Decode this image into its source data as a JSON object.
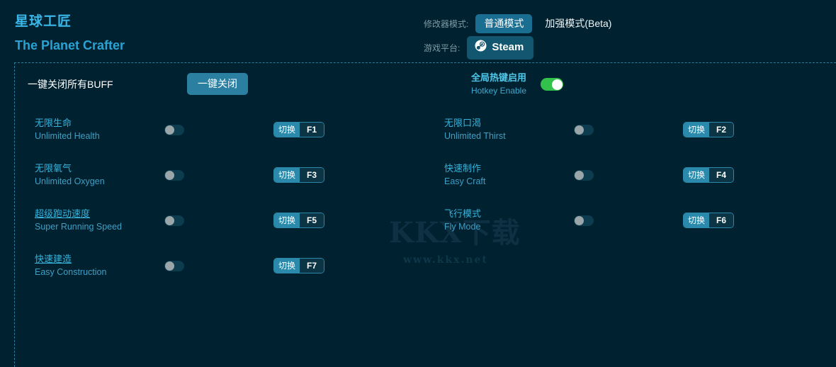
{
  "header": {
    "title_cn": "星球工匠",
    "title_en": "The Planet Crafter",
    "mode_label": "修改器模式:",
    "mode_active": "普通模式",
    "mode_inactive": "加强模式(Beta)",
    "platform_label": "游戏平台:",
    "platform_value": "Steam",
    "platform_icon": "steam-icon"
  },
  "utility": {
    "close_all_label": "一键关闭所有BUFF",
    "close_all_button": "一键关闭",
    "hotkey_cn": "全局热键启用",
    "hotkey_en": "Hotkey Enable",
    "hotkey_state": "on"
  },
  "colors": {
    "background": "#00212f",
    "accent": "#2b89ab",
    "title_cn": "#3ab7e8",
    "title_en": "#2aa3d4",
    "toggle_on": "#32c24b",
    "toggle_off_track": "#0c3c4e",
    "toggle_off_knob": "#9aa6aa",
    "panel_border": "#2a7e9c"
  },
  "cheats": [
    {
      "name_cn": "无限生命",
      "name_en": "Unlimited Health",
      "state": "off",
      "action": "切换",
      "key": "F1",
      "underlined": false,
      "column": 0,
      "row": 0
    },
    {
      "name_cn": "无限口渴",
      "name_en": "Unlimited Thirst",
      "state": "off",
      "action": "切换",
      "key": "F2",
      "underlined": false,
      "column": 1,
      "row": 0
    },
    {
      "name_cn": "无限氧气",
      "name_en": "Unlimited Oxygen",
      "state": "off",
      "action": "切换",
      "key": "F3",
      "underlined": false,
      "column": 0,
      "row": 1
    },
    {
      "name_cn": "快速制作",
      "name_en": "Easy Craft",
      "state": "off",
      "action": "切换",
      "key": "F4",
      "underlined": false,
      "column": 1,
      "row": 1
    },
    {
      "name_cn": "超级跑动速度",
      "name_en": "Super Running Speed",
      "state": "off",
      "action": "切换",
      "key": "F5",
      "underlined": true,
      "column": 0,
      "row": 2
    },
    {
      "name_cn": "飞行模式",
      "name_en": "Fly Mode",
      "state": "off",
      "action": "切换",
      "key": "F6",
      "underlined": false,
      "column": 1,
      "row": 2
    },
    {
      "name_cn": "快速建造",
      "name_en": "Easy Construction",
      "state": "off",
      "action": "切换",
      "key": "F7",
      "underlined": true,
      "column": 0,
      "row": 3
    }
  ],
  "watermark": {
    "logo": "KKX下载",
    "url": "www.kkx.net"
  }
}
